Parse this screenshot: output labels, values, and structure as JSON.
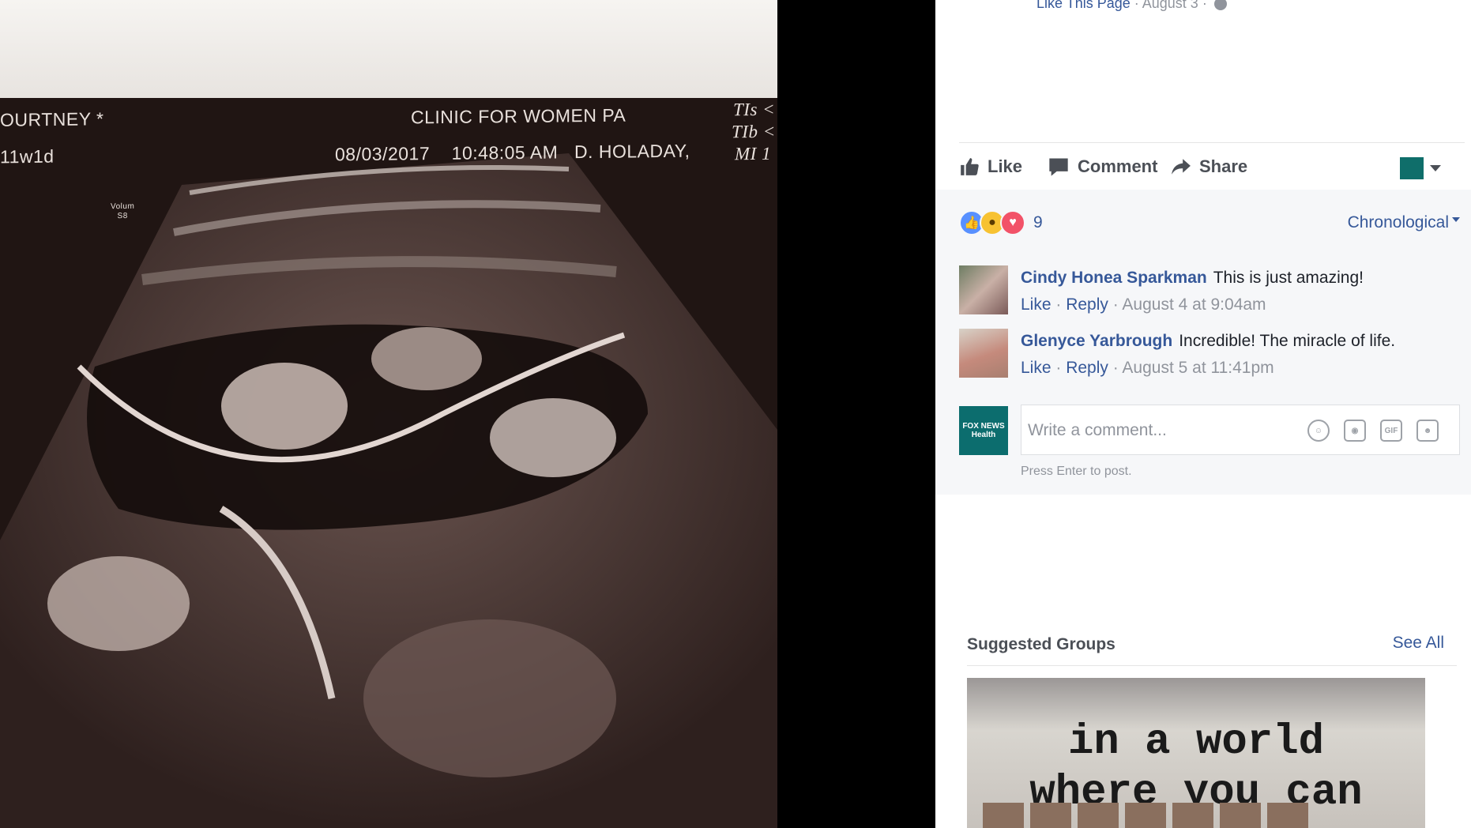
{
  "photo": {
    "patient": "OURTNEY  *",
    "clinic": "CLINIC FOR WOMEN PA",
    "gestational_age": "11w1d",
    "datetime": "08/03/2017    10:48:05 AM   D. HOLADAY,",
    "tis": "TIs <",
    "tib": "TIb <",
    "mi": "MI 1",
    "volume": "Volum\nS8"
  },
  "page_meta": {
    "like_page": "Like This Page",
    "date": "· August 3 ·"
  },
  "actions": {
    "like": "Like",
    "comment": "Comment",
    "share": "Share"
  },
  "reactions": {
    "count": "9",
    "sort": "Chronological"
  },
  "comments": [
    {
      "name": "Cindy Honea Sparkman",
      "text": "This is just amazing!",
      "like": "Like",
      "reply": "Reply",
      "time": "August 4 at 9:04am"
    },
    {
      "name": "Glenyce Yarbrough",
      "text": "Incredible! The miracle of life.",
      "like": "Like",
      "reply": "Reply",
      "time": "August 5 at 11:41pm"
    }
  ],
  "composer": {
    "avatar_text": "FOX NEWS Health",
    "placeholder": "Write a comment...",
    "gif": "GIF",
    "hint": "Press Enter to post."
  },
  "suggested": {
    "title": "Suggested Groups",
    "see_all": "See All",
    "card_text": "in a world\nwhere you can"
  },
  "icons": {
    "like": "thumbs-up-icon",
    "comment": "speech-bubble-icon",
    "share": "share-arrow-icon",
    "emoji": "smiley-icon",
    "camera": "camera-icon",
    "sticker": "sticker-icon"
  },
  "colors": {
    "link": "#365899",
    "meta": "#90949c",
    "like_reaction": "#5890ff",
    "love_reaction": "#f25268",
    "wow_reaction": "#f7c232"
  }
}
